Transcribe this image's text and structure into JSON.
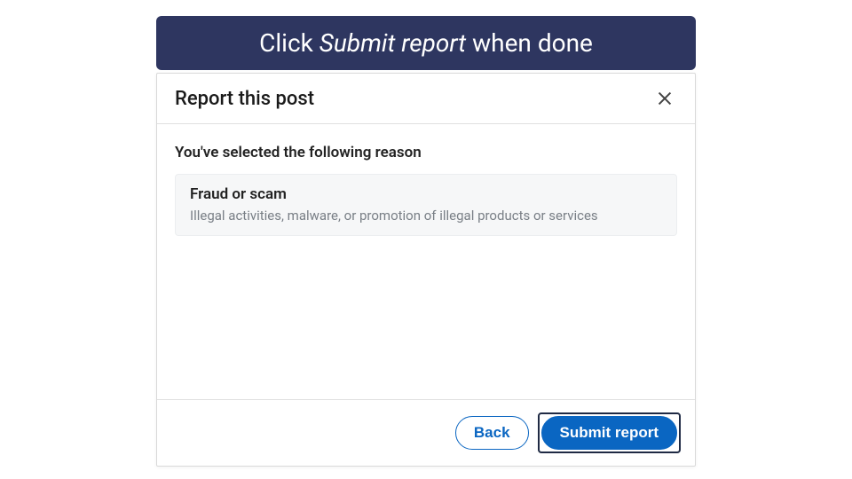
{
  "banner": {
    "prefix": "Click ",
    "emphasis": "Submit report",
    "suffix": " when done"
  },
  "modal": {
    "title": "Report this post",
    "subtitle": "You've selected the following reason",
    "reason": {
      "name": "Fraud or scam",
      "description": "Illegal activities, malware, or promotion of illegal products or services"
    },
    "footer": {
      "back_label": "Back",
      "submit_label": "Submit report"
    }
  }
}
